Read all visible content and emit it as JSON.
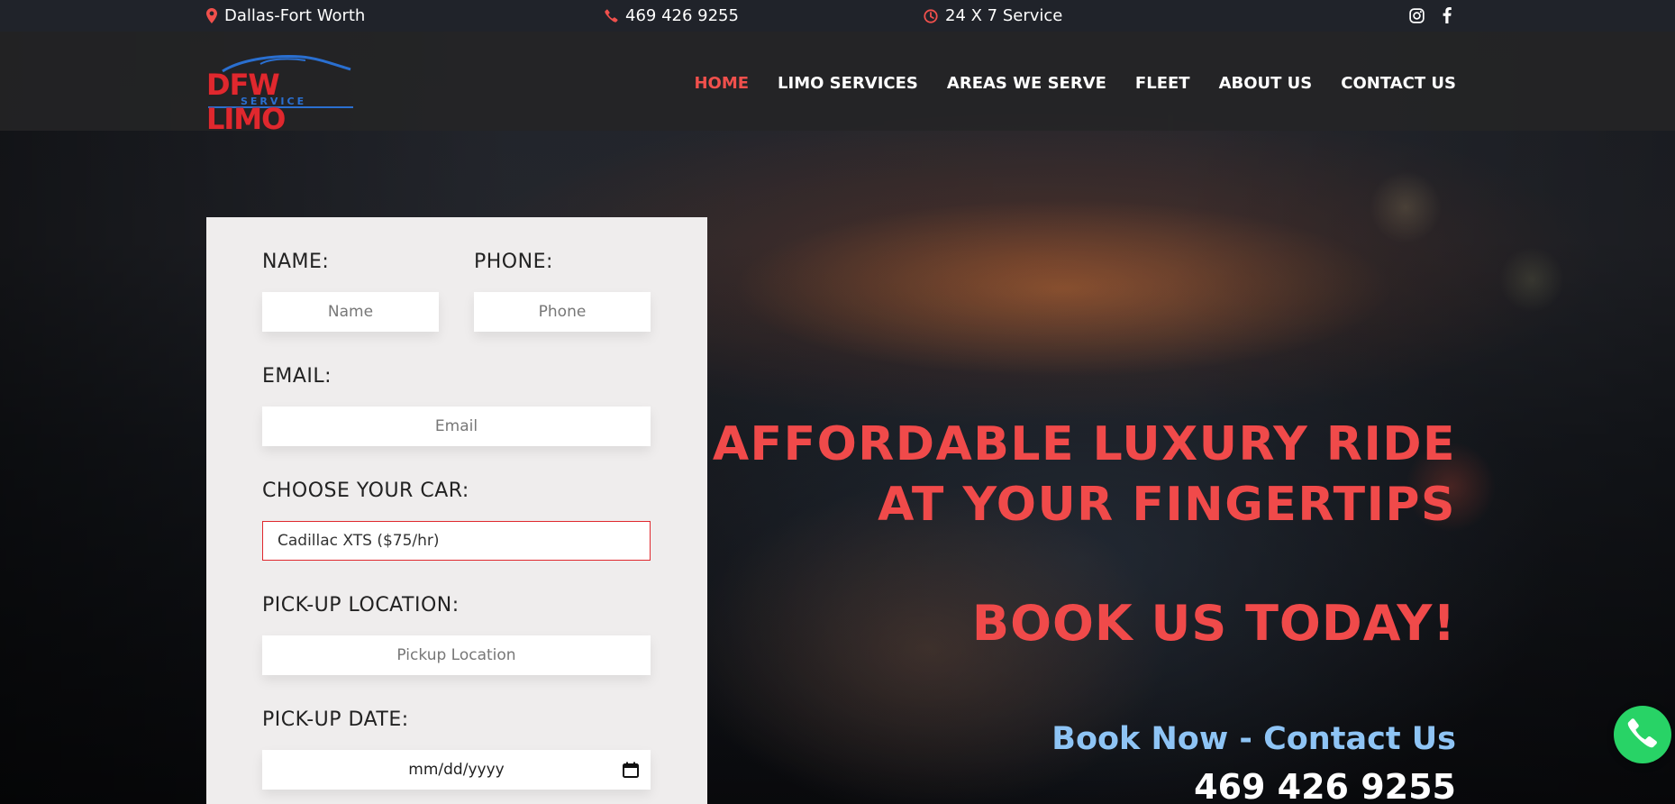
{
  "topbar": {
    "location": "Dallas-Fort Worth",
    "phone": "469 426 9255",
    "service": "24 X 7 Service",
    "icon_location": "map-pin-icon",
    "icon_phone": "phone-icon",
    "icon_service": "clock-icon",
    "social": [
      "instagram-icon",
      "facebook-icon"
    ]
  },
  "logo": {
    "text": "DFW LIMO",
    "sub": "SERVICE"
  },
  "nav": {
    "items": [
      {
        "label": "HOME",
        "active": true
      },
      {
        "label": "LIMO SERVICES"
      },
      {
        "label": "AREAS WE SERVE"
      },
      {
        "label": "FLEET"
      },
      {
        "label": "ABOUT US"
      },
      {
        "label": "CONTACT US"
      }
    ]
  },
  "form": {
    "name_label": "NAME:",
    "name_placeholder": "Name",
    "phone_label": "PHONE:",
    "phone_placeholder": "Phone",
    "email_label": "EMAIL:",
    "email_placeholder": "Email",
    "car_label": "CHOOSE YOUR CAR:",
    "car_value": "Cadillac XTS ($75/hr)",
    "pickup_label": "PICK-UP LOCATION:",
    "pickup_placeholder": "Pickup Location",
    "date_label": "PICK-UP DATE:",
    "date_placeholder": "mm/dd/yyyy"
  },
  "hero": {
    "line1": "AFFORDABLE LUXURY RIDE",
    "line2": "AT YOUR FINGERTIPS",
    "book": "BOOK US TODAY!",
    "cta": "Book Now - Contact Us",
    "phone": "469 426 9255"
  },
  "colors": {
    "accent": "#f04a4a",
    "link": "#8ec4f5",
    "whatsapp": "#28d366"
  }
}
